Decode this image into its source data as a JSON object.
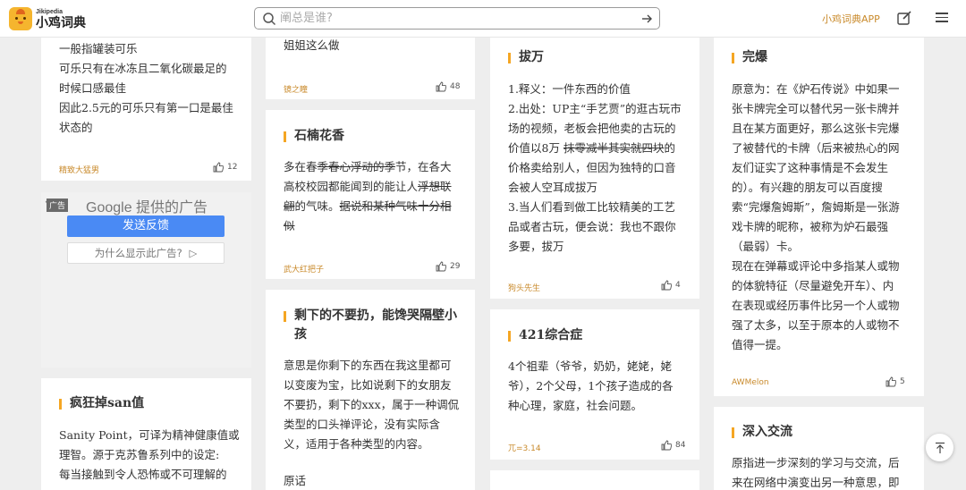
{
  "header": {
    "logo_small": "Jikipedia",
    "logo_big": "小鸡词典",
    "search_placeholder": "阐总是谁?",
    "app_link": "小鸡词典APP"
  },
  "ad": {
    "tag": "广告",
    "google_label": "Google 提供的广告",
    "feedback_button": "发送反馈",
    "why_button": "为什么显示此广告?"
  },
  "col1": {
    "card_a": {
      "lines": [
        "一般指罐装可乐",
        "可乐只有在冰冻且二氧化碳最足的",
        "时候口感最佳",
        "因此2.5元的可乐只有第一口是最佳",
        "状态的"
      ],
      "author": "精致大猛男",
      "likes": "12"
    },
    "card_b": {
      "title": "疯狂掉san值",
      "lines": [
        "Sanity Point，可译为精神健康值或",
        "理智。源于克苏鲁系列中的设定:",
        "每当接触到令人恐怖或不可理解的"
      ]
    }
  },
  "col2": {
    "card_a": {
      "lines": [
        "姐姐这么做"
      ],
      "author": "镜之瞳",
      "likes": "48"
    },
    "card_b": {
      "title": "石楠花香",
      "l1": "多在春",
      "l1_strike": "季春心浮动的季",
      "l1_end": "节，在各大",
      "l2_start": "高校校园都能闻到的能让人",
      "l2_strike": "浮想联",
      "l3_strike1": "翩",
      "l3_mid": "的气味。",
      "l3_strike2": "据说和某种气味十分相",
      "l4_strike": "似",
      "author": "武大红把子",
      "likes": "29"
    },
    "card_c": {
      "title_line1": "剩下的不要扔，能馋哭隔壁小",
      "title_line2": "孩",
      "lines": [
        "意思是你剩下的东西在我这里都可",
        "以变废为宝，比如说剩下的女朋友",
        "不要扔，剩下的xxx，属于一种调侃",
        "类型的口头禅评论，没有实际含",
        "义，适用于各种类型的内容。"
      ],
      "extra": "原话"
    }
  },
  "col3": {
    "card_a": {
      "title": "拔万",
      "line1": "1.释义：一件东西的价值",
      "line2": "2.出处：UP主“手艺贾”的逛古玩市",
      "line3": "场的视频，老板会把他卖的古玩的",
      "line4_start": "价值以8万 ",
      "line4_strike": "抹零减半其实就四块",
      "line4_end": "的",
      "line5": "价格卖给别人，但因为独特的口音",
      "line6": "会被人空耳成拔万",
      "line7": "3.当人们看到做工比较精美的工艺",
      "line8": "品或者古玩，便会说：我也不跟你",
      "line9": "多要，拔万",
      "author": "狗头先生",
      "likes": "4"
    },
    "card_b": {
      "title": "421综合症",
      "lines": [
        "4个祖辈（爷爷，奶奶，姥姥，姥",
        "爷），2个父母，1个孩子造成的各",
        "种心理，家庭，社会问题。"
      ],
      "author": "兀=3.14",
      "likes": "84"
    }
  },
  "col4": {
    "card_a": {
      "title": "完爆",
      "lines": [
        "原意为：在《炉石传说》中如果一",
        "张卡牌完全可以替代另一张卡牌并",
        "且在某方面更好，那么这张卡完爆",
        "了被替代的卡牌（后来被热心的网",
        "友们证实了这种事情是不会发生",
        "的）。有兴趣的朋友可以百度搜",
        "索“完爆詹姆斯”，詹姆斯是一张游",
        "戏卡牌的昵称，被称为炉石最强",
        "（最弱）卡。",
        "现在在弹幕或评论中多指某人或物",
        "的体貌特征（尽量避免开车）、内",
        "在表现或经历事件比另一个人或物",
        "强了太多，以至于原本的人或物不",
        "值得一提。"
      ],
      "author": "AWMelon",
      "likes": "5"
    },
    "card_b": {
      "title": "深入交流",
      "lines": [
        "原指进一步深刻的学习与交流，后",
        "来在网络中演变出另一种意思，即"
      ]
    }
  }
}
